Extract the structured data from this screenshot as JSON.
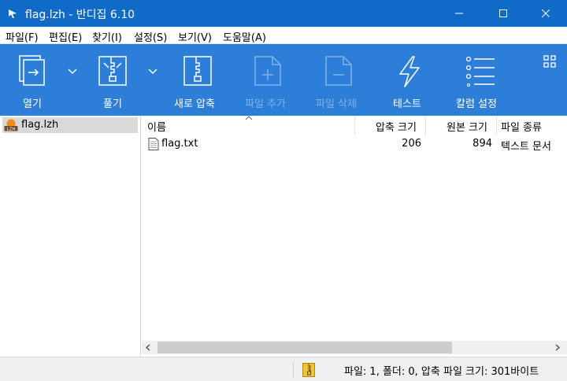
{
  "window": {
    "title": "flag.lzh - 반디집 6.10"
  },
  "menu": [
    {
      "label": "파일(F)"
    },
    {
      "label": "편집(E)"
    },
    {
      "label": "찾기(I)"
    },
    {
      "label": "설정(S)"
    },
    {
      "label": "보기(V)"
    },
    {
      "label": "도움말(A)"
    }
  ],
  "toolbar": {
    "open_label": "열기",
    "extract_label": "풀기",
    "new_archive_label": "새로 압축",
    "add_files_label": "파일 추가",
    "delete_files_label": "파일 삭제",
    "test_label": "테스트",
    "column_settings_label": "칼럼 설정"
  },
  "tree": {
    "items": [
      {
        "label": "flag.lzh",
        "icon": "lzh-archive-icon"
      }
    ]
  },
  "list": {
    "columns": [
      "이름",
      "압축 크기",
      "원본 크기",
      "파일 종류"
    ],
    "rows": [
      {
        "name": "flag.txt",
        "compressed": "206",
        "original": "894",
        "type": "텍스트 문서"
      }
    ]
  },
  "status": {
    "text": "파일: 1, 폴더: 0, 압축 파일 크기: 301바이트"
  },
  "colors": {
    "titlebar": "#0f6ac8",
    "toolbar": "#2d7ed8",
    "disabled_label": "#7fb2e8"
  }
}
